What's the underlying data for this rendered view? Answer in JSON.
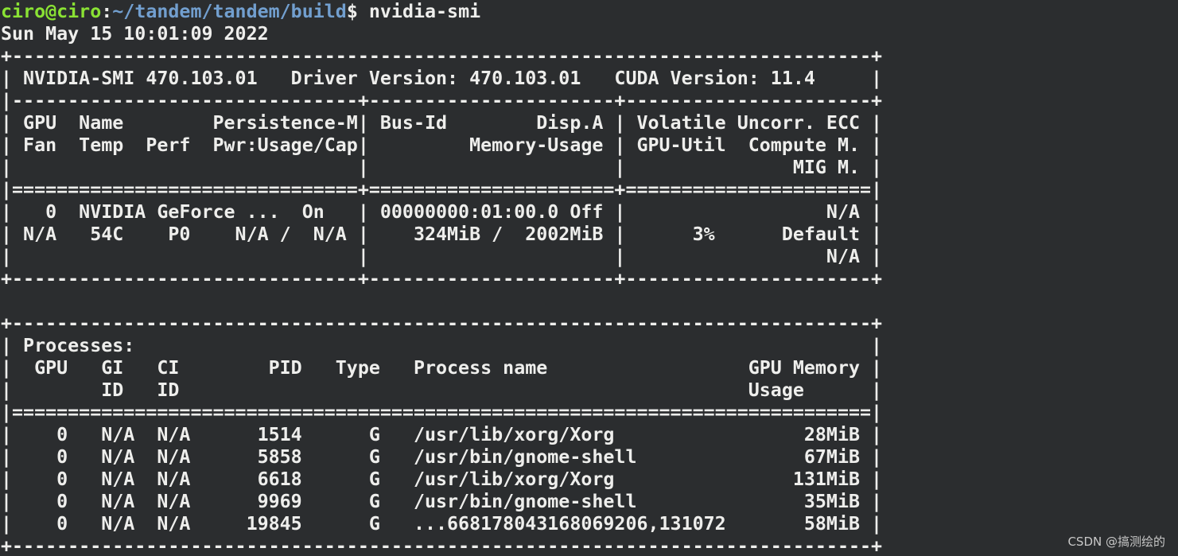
{
  "prompt": {
    "user_host": "ciro@ciro",
    "separator": ":",
    "path": "~/tandem/tandem/build",
    "symbol": "$",
    "command": " nvidia-smi"
  },
  "output_lines": [
    "Sun May 15 10:01:09 2022",
    "+-----------------------------------------------------------------------------+",
    "| NVIDIA-SMI 470.103.01   Driver Version: 470.103.01   CUDA Version: 11.4     |",
    "|-------------------------------+----------------------+----------------------+",
    "| GPU  Name        Persistence-M| Bus-Id        Disp.A | Volatile Uncorr. ECC |",
    "| Fan  Temp  Perf  Pwr:Usage/Cap|         Memory-Usage | GPU-Util  Compute M. |",
    "|                               |                      |               MIG M. |",
    "|===============================+======================+======================|",
    "|   0  NVIDIA GeForce ...  On   | 00000000:01:00.0 Off |                  N/A |",
    "| N/A   54C    P0    N/A /  N/A |    324MiB /  2002MiB |      3%      Default |",
    "|                               |                      |                  N/A |",
    "+-------------------------------+----------------------+----------------------+",
    "",
    "+-----------------------------------------------------------------------------+",
    "| Processes:                                                                  |",
    "|  GPU   GI   CI        PID   Type   Process name                  GPU Memory |",
    "|        ID   ID                                                   Usage      |",
    "|=============================================================================|",
    "|    0   N/A  N/A      1514      G   /usr/lib/xorg/Xorg                 28MiB |",
    "|    0   N/A  N/A      5858      G   /usr/bin/gnome-shell               67MiB |",
    "|    0   N/A  N/A      6618      G   /usr/lib/xorg/Xorg                131MiB |",
    "|    0   N/A  N/A      9969      G   /usr/bin/gnome-shell               35MiB |",
    "|    0   N/A  N/A     19845      G   ...668178043168069206,131072       58MiB |",
    "+-----------------------------------------------------------------------------+"
  ],
  "watermark": "CSDN @搞测绘的",
  "colors": {
    "background": "#2b2d2f",
    "text": "#eeeeec",
    "user_host": "#8ae234",
    "path": "#729fcf"
  }
}
